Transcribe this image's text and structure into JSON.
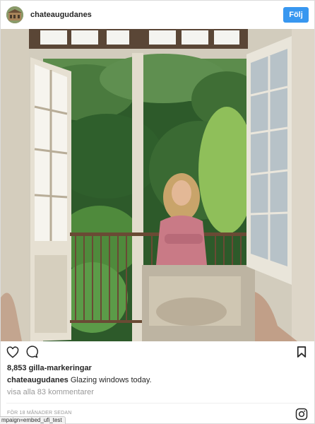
{
  "post": {
    "username": "chateaugudanes",
    "follow_label": "Följ",
    "likes_text": "8,853 gilla-markeringar",
    "caption_username": "chateaugudanes",
    "caption_text": "Glazing windows today.",
    "view_comments": "visa alla 83 kommentarer",
    "timestamp": "FÖR 18 MÅNADER SEDAN"
  },
  "browser": {
    "status_url": "mpaign=embed_ufi_test"
  },
  "colors": {
    "follow_button": "#3897f0",
    "muted_text": "#999999",
    "border": "#dbdbdb"
  },
  "icons": {
    "like": "heart-icon",
    "comment": "comment-bubble-icon",
    "save": "bookmark-icon",
    "brand": "instagram-icon"
  }
}
